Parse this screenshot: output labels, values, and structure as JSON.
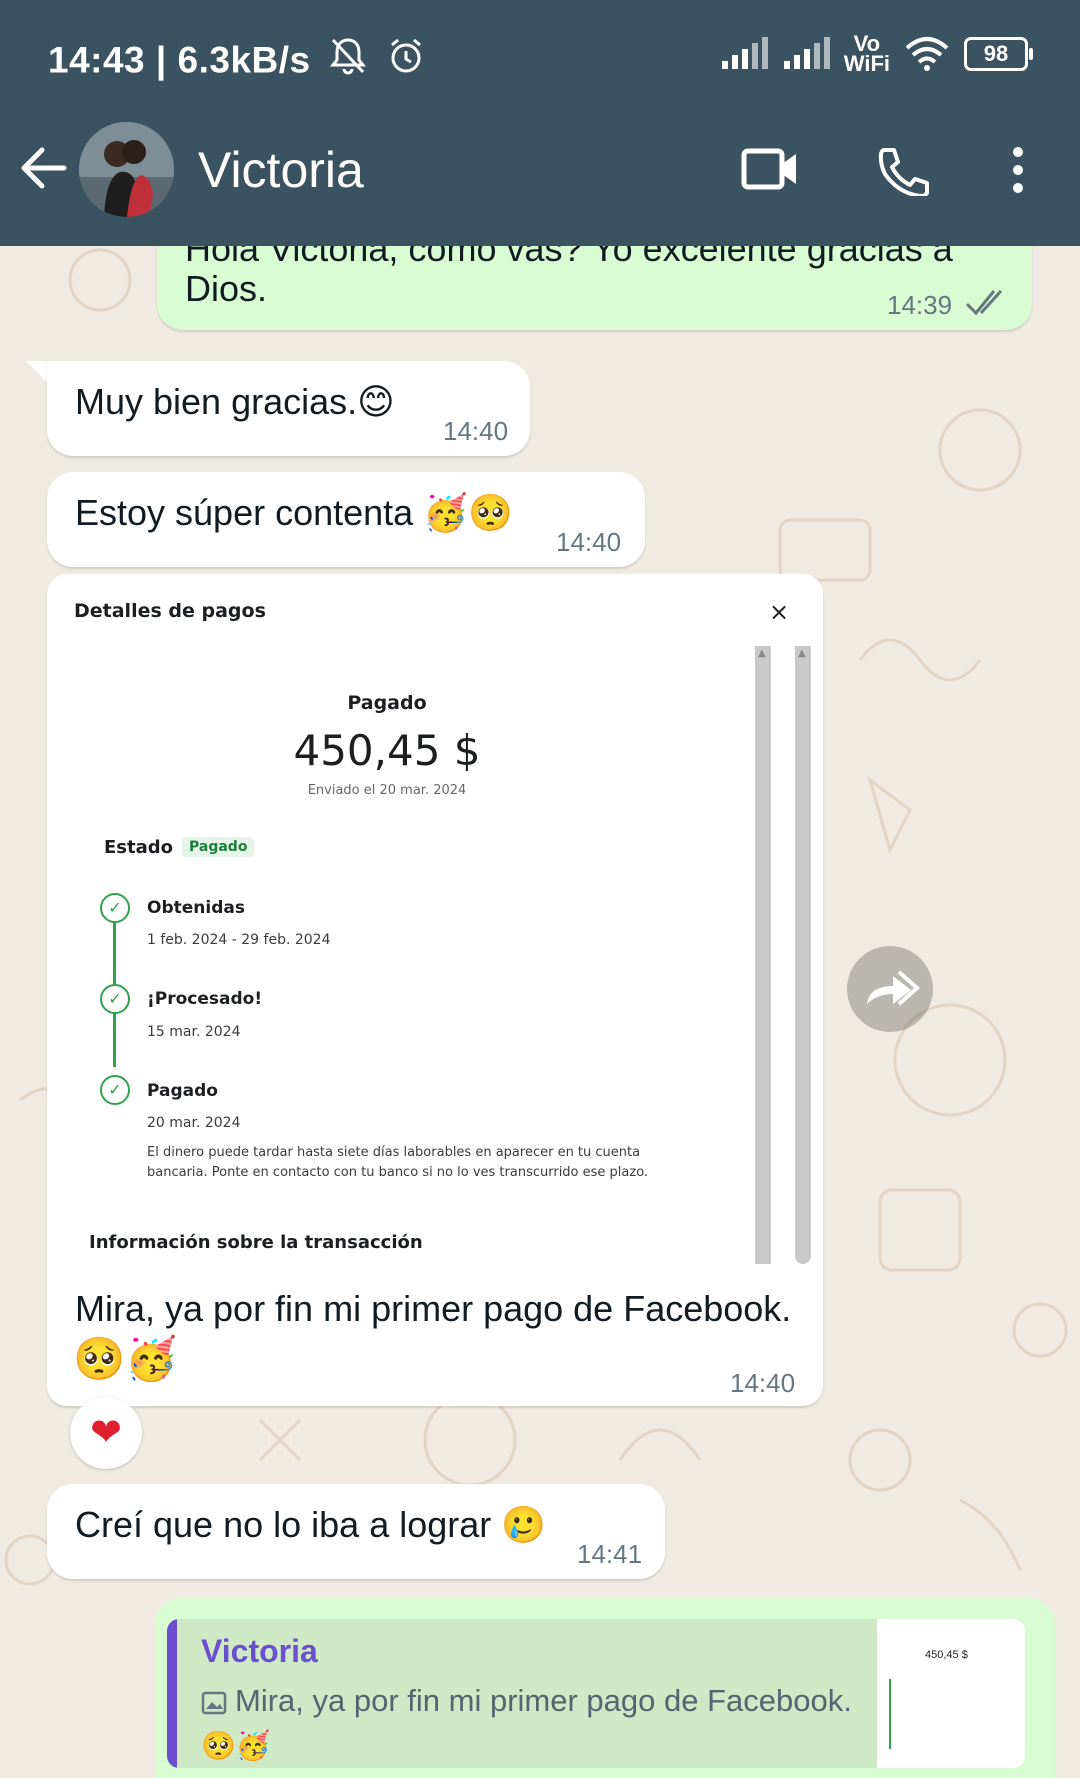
{
  "status_bar": {
    "time_speed": "14:43 | 6.3kB/s",
    "volte_top": "Vo",
    "volte_bottom": "WiFi",
    "battery": "98"
  },
  "header": {
    "contact_name": "Victoria"
  },
  "messages": [
    {
      "id": "m1",
      "direction": "out",
      "text_line1": "Hola Victoria, como vas? Yo excelente gracias a",
      "text_line2": "Dios.",
      "time": "14:39"
    },
    {
      "id": "m2",
      "direction": "in",
      "text": "Muy bien gracias.",
      "emoji": "😊",
      "time": "14:40"
    },
    {
      "id": "m3",
      "direction": "in",
      "text": "Estoy súper contenta",
      "emoji": "🥳🥺",
      "time": "14:40"
    },
    {
      "id": "m4",
      "direction": "in",
      "caption": "Mira, ya por fin mi primer pago de Facebook.",
      "emoji": "🥺🥳",
      "time": "14:40",
      "reaction": "❤"
    },
    {
      "id": "m5",
      "direction": "in",
      "text": "Creí que no lo iba a lograr",
      "emoji": "🥲",
      "time": "14:41"
    }
  ],
  "payment_card": {
    "title": "Detalles de pagos",
    "close": "×",
    "status_label": "Pagado",
    "amount": "450,45 $",
    "sent_date": "Enviado el 20 mar. 2024",
    "estado_label": "Estado",
    "estado_badge": "Pagado",
    "steps": [
      {
        "title": "Obtenidas",
        "date": "1 feb. 2024 - 29 feb. 2024"
      },
      {
        "title": "¡Procesado!",
        "date": "15 mar. 2024"
      },
      {
        "title": "Pagado",
        "date": "20 mar. 2024"
      }
    ],
    "note": "El dinero puede tardar hasta siete días laborables en aparecer en tu cuenta bancaria. Ponte en contacto con tu banco si no lo ves transcurrido ese plazo.",
    "info_title": "Información sobre la transacción"
  },
  "reply": {
    "quoted_name": "Victoria",
    "quoted_text": "Mira, ya por fin mi primer pago de Facebook.",
    "quoted_emoji": "🥺🥳",
    "thumb_amount": "450,45 $"
  },
  "colors": {
    "header_bg": "#3b5260",
    "incoming_bubble": "#ffffff",
    "outgoing_bubble": "#d9fdd3",
    "wallpaper": "#efeae2",
    "quote_accent": "#6b4fcf"
  }
}
